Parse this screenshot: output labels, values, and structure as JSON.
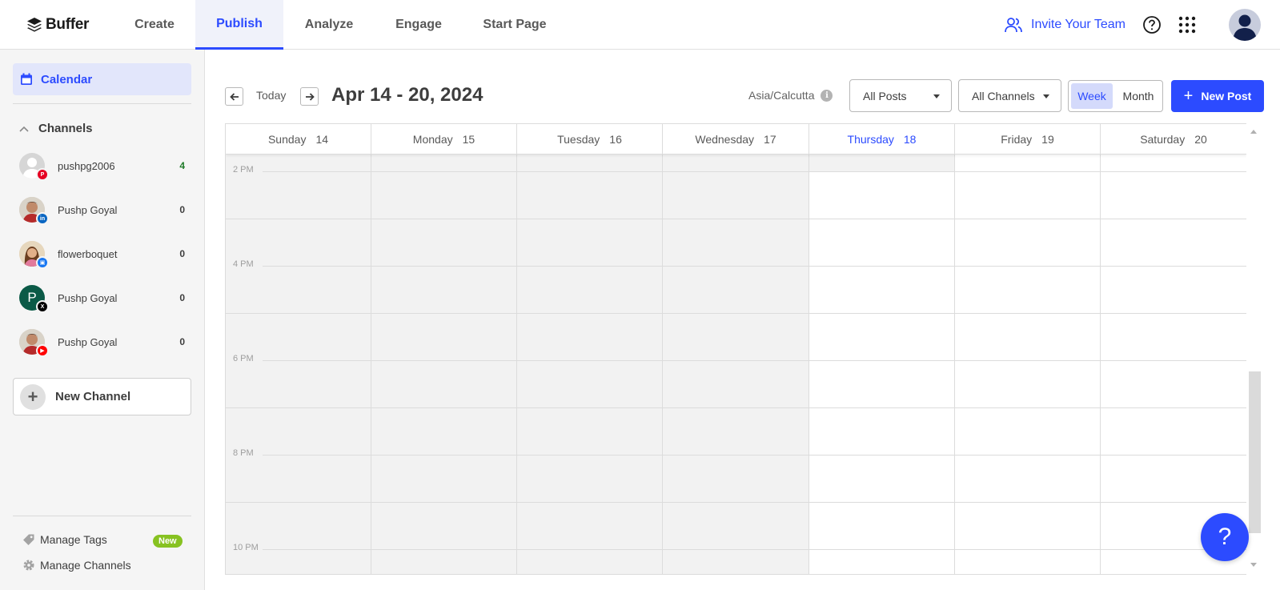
{
  "brand": {
    "name": "Buffer",
    "accent": "#2c4bff"
  },
  "nav": {
    "tabs": [
      {
        "label": "Create",
        "active": false
      },
      {
        "label": "Publish",
        "active": true
      },
      {
        "label": "Analyze",
        "active": false
      },
      {
        "label": "Engage",
        "active": false
      },
      {
        "label": "Start Page",
        "active": false
      }
    ],
    "invite_label": "Invite Your Team",
    "icons": [
      "users-icon",
      "help-icon",
      "apps-grid-icon",
      "user-avatar-icon"
    ]
  },
  "sidebar": {
    "calendar_label": "Calendar",
    "channels_label": "Channels",
    "channels": [
      {
        "name": "pushpg2006",
        "count": "4",
        "network": "pinterest",
        "badge_color": "#e60023"
      },
      {
        "name": "Pushp Goyal",
        "count": "0",
        "network": "linkedin",
        "badge_color": "#0a66c2"
      },
      {
        "name": "flowerboquet",
        "count": "0",
        "network": "facebook-page",
        "badge_color": "#1877f2"
      },
      {
        "name": "Pushp Goyal",
        "count": "0",
        "network": "x-twitter",
        "badge_color": "#000000",
        "avatar_letter": "P"
      },
      {
        "name": "Pushp Goyal",
        "count": "0",
        "network": "youtube",
        "badge_color": "#ff0000"
      }
    ],
    "new_channel_label": "New Channel",
    "manage_tags_label": "Manage Tags",
    "new_badge": "New",
    "manage_channels_label": "Manage Channels"
  },
  "toolbar": {
    "today_label": "Today",
    "date_range": "Apr 14 - 20, 2024",
    "timezone": "Asia/Calcutta",
    "posts_filter": "All Posts",
    "channels_filter": "All Channels",
    "view_week": "Week",
    "view_month": "Month",
    "active_view": "Week",
    "new_post_label": "New Post"
  },
  "calendar": {
    "days": [
      {
        "name": "Sunday",
        "date": "14",
        "past": true
      },
      {
        "name": "Monday",
        "date": "15",
        "past": true
      },
      {
        "name": "Tuesday",
        "date": "16",
        "past": true
      },
      {
        "name": "Wednesday",
        "date": "17",
        "past": true
      },
      {
        "name": "Thursday",
        "date": "18",
        "today": true
      },
      {
        "name": "Friday",
        "date": "19"
      },
      {
        "name": "Saturday",
        "date": "20"
      }
    ],
    "time_labels": [
      "2 PM",
      "4 PM",
      "6 PM",
      "8 PM",
      "10 PM"
    ]
  },
  "help_fab": "?"
}
